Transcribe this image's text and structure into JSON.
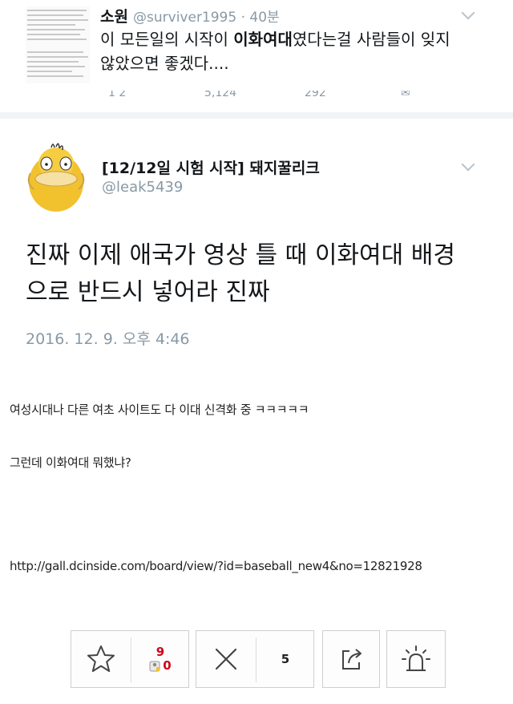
{
  "quoted_tweet": {
    "name": "소원",
    "handle_time": "@surviver1995 · 40분",
    "text_before": "이 모든일의 시작이 ",
    "text_bold": "이화여대",
    "text_after": "였다는걸 사람들이 잊지 않았으면 좋겠다....",
    "actions_partial": [
      "1 2",
      "5,124",
      "292"
    ]
  },
  "main_tweet": {
    "name": "[12/12일 시험 시작] 돼지꿀리크",
    "handle": "@leak5439",
    "text": "진짜 이제 애국가 영상 틀 때 이화여대 배경으로 반드시 넣어라 진짜",
    "date": "2016. 12. 9. 오후 4:46"
  },
  "post": {
    "line1": "여성시대나 다른 여초 사이트도 다 이대 신격화 중 ㅋㅋㅋㅋㅋ",
    "line2": "그런데 이화여대 뭐했냐?",
    "url": "http://gall.dcinside.com/board/view/?id=baseball_new4&no=12821928"
  },
  "action_bar": {
    "recommend_count": "9",
    "fixed_count": "0",
    "dislike_count": "5"
  },
  "colors": {
    "handle_gray": "#8899a6",
    "recommend_red": "#d0021b",
    "avatar_yellow": "#f2c12e"
  },
  "icons": [
    "chevron-down-icon",
    "star-icon",
    "x-icon",
    "share-icon",
    "alert-siren-icon",
    "psyduck-avatar"
  ]
}
